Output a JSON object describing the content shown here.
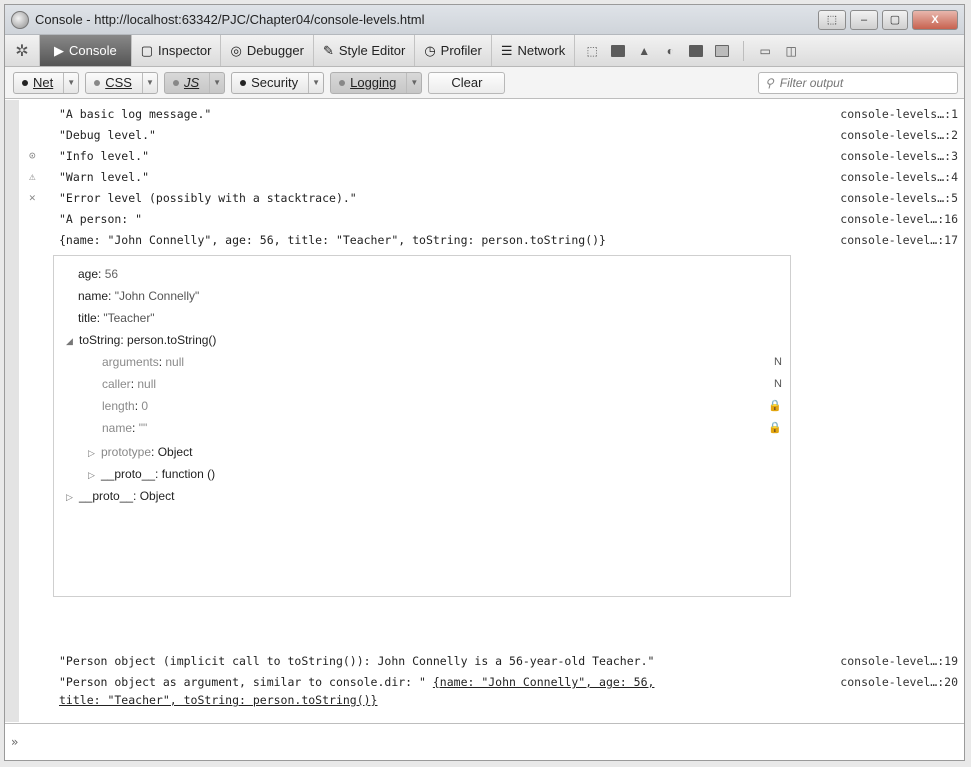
{
  "window": {
    "title": "Console - http://localhost:63342/PJC/Chapter04/console-levels.html",
    "buttons": {
      "extra": "⬚",
      "minimize": "–",
      "maximize": "▢",
      "close": "X"
    }
  },
  "toolbar": {
    "tabs": [
      {
        "icon": "▶",
        "label": "Console",
        "active": true
      },
      {
        "icon": "▢",
        "label": "Inspector"
      },
      {
        "icon": "◎",
        "label": "Debugger"
      },
      {
        "icon": "✎",
        "label": "Style Editor"
      },
      {
        "icon": "◷",
        "label": "Profiler"
      },
      {
        "icon": "☰",
        "label": "Network"
      }
    ]
  },
  "filters": {
    "net": "Net",
    "css": "CSS",
    "js": "JS",
    "security": "Security",
    "logging": "Logging",
    "clear": "Clear",
    "filter_placeholder": "Filter output"
  },
  "messages": [
    {
      "sev": "",
      "text": "\"A basic log message.\"",
      "loc": "console-levels…:1"
    },
    {
      "sev": "",
      "text": "\"Debug level.\"",
      "loc": "console-levels…:2"
    },
    {
      "sev": "⊙",
      "text": "\"Info level.\"",
      "loc": "console-levels…:3"
    },
    {
      "sev": "⚠",
      "text": "\"Warn level.\"",
      "loc": "console-levels…:4"
    },
    {
      "sev": "✕",
      "text": "\"Error level (possibly with a stacktrace).\"",
      "loc": "console-levels…:5"
    },
    {
      "sev": "",
      "text": "\"A person: \"",
      "loc": "console-level…:16"
    },
    {
      "sev": "",
      "text": "{name: \"John Connelly\", age: 56, title: \"Teacher\", toString: person.toString()}",
      "loc": "console-level…:17"
    }
  ],
  "inspector": {
    "props": [
      {
        "key": "age",
        "value": "56"
      },
      {
        "key": "name",
        "value": "\"John Connelly\""
      },
      {
        "key": "title",
        "value": "\"Teacher\""
      },
      {
        "key": "toString",
        "value": "person.toString()",
        "twisty": "◢"
      },
      {
        "key": "arguments",
        "value": "null",
        "flag": "N"
      },
      {
        "key": "caller",
        "value": "null",
        "flag": "N"
      },
      {
        "key": "length",
        "value": "0",
        "flag": "🔒"
      },
      {
        "key": "name",
        "value": "\"\"",
        "flag": "🔒"
      },
      {
        "key": "prototype",
        "value": "Object",
        "twisty": "▷"
      },
      {
        "key": "__proto__",
        "value": "function ()",
        "twisty": "▷"
      },
      {
        "key": "__proto__",
        "value": "Object",
        "twisty": "▷"
      }
    ]
  },
  "messages_after": [
    {
      "text": "\"Person object (implicit call to toString()): John Connelly is a 56-year-old Teacher.\"",
      "loc": "console-level…:19"
    },
    {
      "text": "\"Person object as argument, similar to console.dir: \" ",
      "link1": "{name: \"John Connelly\", age: 56,",
      "link2": "title: \"Teacher\", toString: person.toString()}",
      "loc": "console-level…:20"
    }
  ],
  "cmdline": {
    "prompt": "»"
  }
}
